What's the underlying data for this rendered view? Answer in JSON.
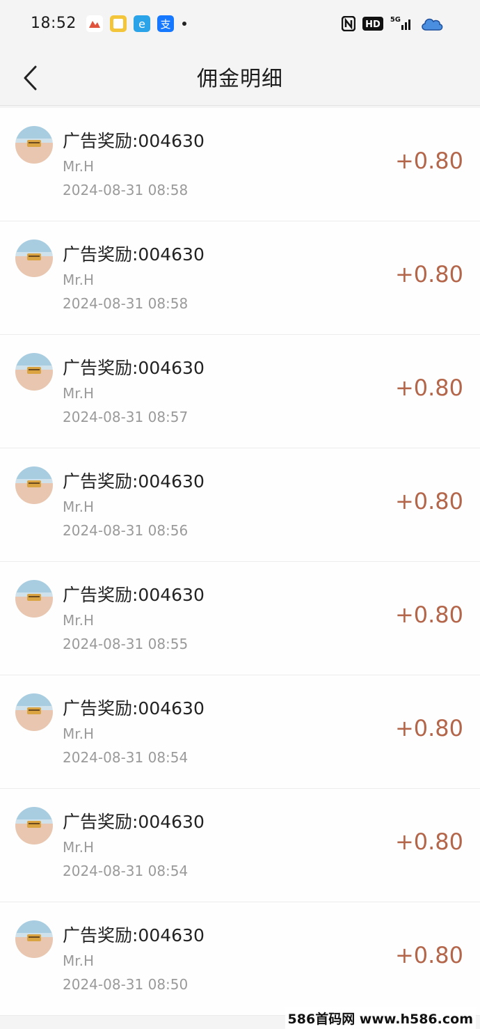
{
  "status": {
    "time": "18:52",
    "app_icons": [
      "photos-icon",
      "notes-icon",
      "browser-icon",
      "alipay-icon"
    ],
    "app_icon_colors": [
      "#e0533d",
      "#f3c53a",
      "#2aa3e8",
      "#1677ff"
    ],
    "network": "5G",
    "hd_label": "HD"
  },
  "header": {
    "title": "佣金明细"
  },
  "records": [
    {
      "title": "广告奖励:004630",
      "name": "Mr.H",
      "time": "2024-08-31 08:58",
      "amount": "+0.80"
    },
    {
      "title": "广告奖励:004630",
      "name": "Mr.H",
      "time": "2024-08-31 08:58",
      "amount": "+0.80"
    },
    {
      "title": "广告奖励:004630",
      "name": "Mr.H",
      "time": "2024-08-31 08:57",
      "amount": "+0.80"
    },
    {
      "title": "广告奖励:004630",
      "name": "Mr.H",
      "time": "2024-08-31 08:56",
      "amount": "+0.80"
    },
    {
      "title": "广告奖励:004630",
      "name": "Mr.H",
      "time": "2024-08-31 08:55",
      "amount": "+0.80"
    },
    {
      "title": "广告奖励:004630",
      "name": "Mr.H",
      "time": "2024-08-31 08:54",
      "amount": "+0.80"
    },
    {
      "title": "广告奖励:004630",
      "name": "Mr.H",
      "time": "2024-08-31 08:54",
      "amount": "+0.80"
    },
    {
      "title": "广告奖励:004630",
      "name": "Mr.H",
      "time": "2024-08-31 08:50",
      "amount": "+0.80"
    }
  ],
  "watermark": "586首码网 www.h586.com",
  "colors": {
    "amount": "#b3664a",
    "background": "#f4f4f4"
  }
}
